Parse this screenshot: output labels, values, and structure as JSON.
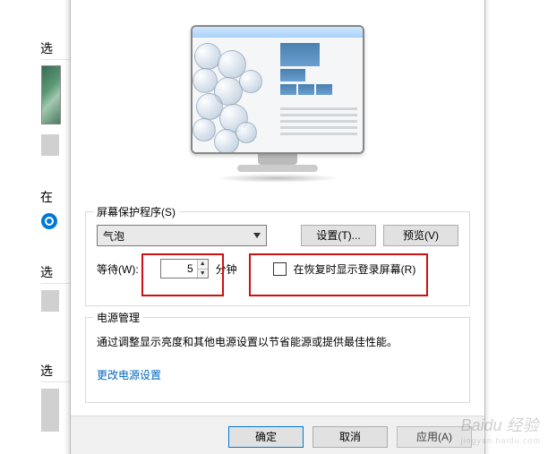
{
  "background": {
    "labels": [
      "选",
      "在",
      "选",
      "选"
    ]
  },
  "screensaver": {
    "group_label": "屏幕保护程序(S)",
    "selected": "气泡",
    "settings_btn": "设置(T)...",
    "preview_btn": "预览(V)",
    "wait_label": "等待(W):",
    "wait_value": "5",
    "wait_unit": "分钟",
    "resume_checkbox": "在恢复时显示登录屏幕(R)"
  },
  "power": {
    "group_label": "电源管理",
    "text": "通过调整显示亮度和其他电源设置以节省能源或提供最佳性能。",
    "link": "更改电源设置"
  },
  "buttons": {
    "ok": "确定",
    "cancel": "取消",
    "apply": "应用(A)"
  },
  "watermark": {
    "main": "Baidu 经验",
    "sub": "jingyan.baidu.com"
  }
}
